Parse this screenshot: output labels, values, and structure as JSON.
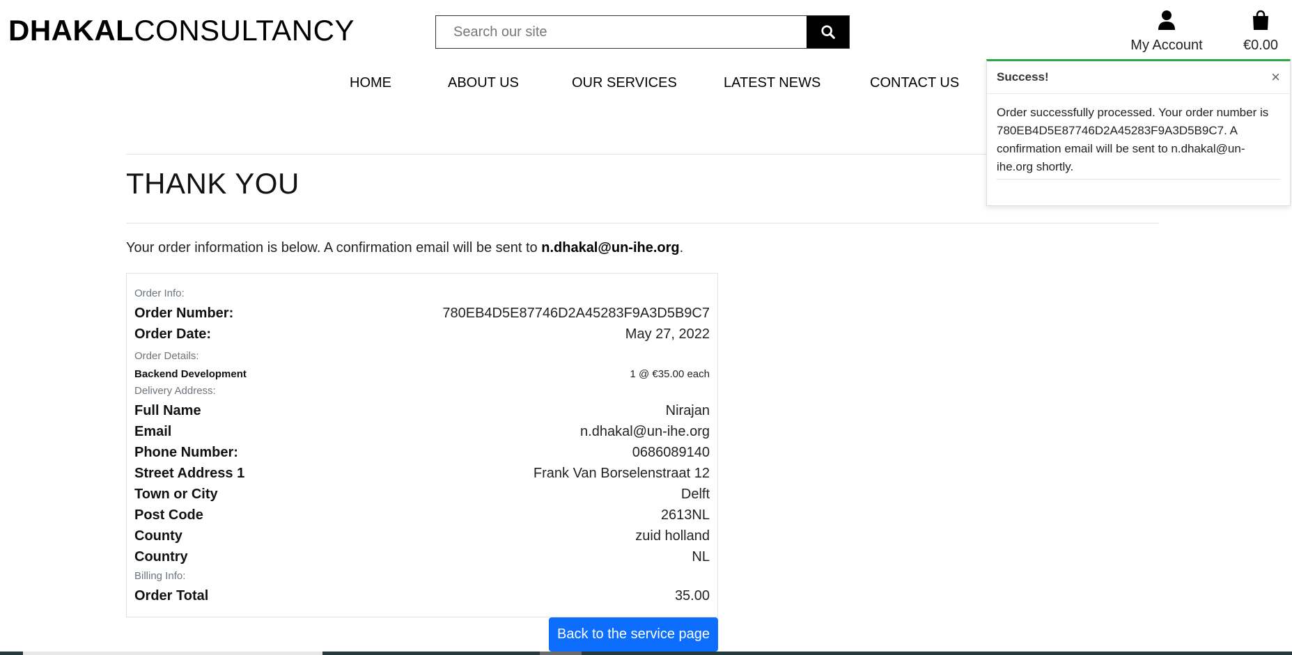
{
  "header": {
    "logo_bold": "DHAKAL",
    "logo_light": "CONSULTANCY",
    "search_placeholder": "Search our site",
    "account_label": "My Account",
    "bag_total": "€0.00"
  },
  "nav": {
    "items": [
      "HOME",
      "ABOUT US",
      "OUR SERVICES",
      "LATEST NEWS",
      "CONTACT US"
    ]
  },
  "main": {
    "title": "THANK YOU",
    "intro_text": "Your order information is below. A confirmation email will be sent to ",
    "intro_email": "n.dhakal@un-ihe.org",
    "intro_end": ".",
    "order_info_label": "Order Info:",
    "order_number_label": "Order Number:",
    "order_number": "780EB4D5E87746D2A45283F9A3D5B9C7",
    "order_date_label": "Order Date:",
    "order_date": "May 27, 2022",
    "order_details_label": "Order Details:",
    "item_name": "Backend Development",
    "item_qty": "1 @ €35.00 each",
    "delivery_label": "Delivery Address:",
    "full_name_label": "Full Name",
    "full_name": "Nirajan",
    "email_label": "Email",
    "email": "n.dhakal@un-ihe.org",
    "phone_label": "Phone Number:",
    "phone": "0686089140",
    "street_label": "Street Address 1",
    "street": "Frank Van Borselenstraat 12",
    "town_label": "Town or City",
    "town": "Delft",
    "postcode_label": "Post Code",
    "postcode": "2613NL",
    "county_label": "County",
    "county": "zuid holland",
    "country_label": "Country",
    "country": "NL",
    "billing_label": "Billing Info:",
    "total_label": "Order Total",
    "total": "35.00",
    "back_button": "Back to the service page"
  },
  "toast": {
    "title": "Success!",
    "close": "×",
    "message": "Order successfully processed. Your order number is 780EB4D5E87746D2A45283F9A3D5B9C7. A confirmation email will be sent to n.dhakal@un-ihe.org shortly."
  },
  "colors": {
    "primary_button": "#0d6efd",
    "toast_accent": "#28a745",
    "bottom_bar": "#243a3c"
  },
  "icons": {
    "search": "search-icon",
    "account": "user-icon",
    "bag": "shopping-bag-icon",
    "close": "close-icon"
  }
}
